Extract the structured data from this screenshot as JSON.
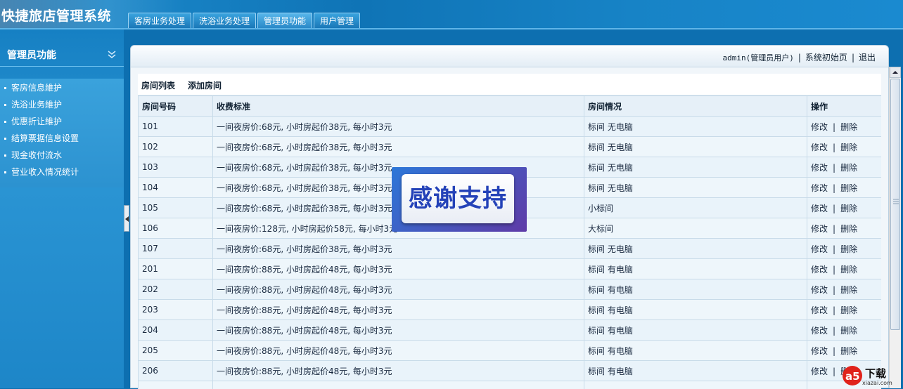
{
  "app": {
    "title": "快捷旅店管理系统"
  },
  "topnav": {
    "tabs": [
      {
        "label": "客房业务处理"
      },
      {
        "label": "洗浴业务处理"
      },
      {
        "label": "管理员功能"
      },
      {
        "label": "用户管理"
      }
    ],
    "active_index": 2
  },
  "sidebar": {
    "title": "管理员功能",
    "items": [
      {
        "label": "客房信息維护"
      },
      {
        "label": "洗浴业务維护"
      },
      {
        "label": "优惠折让維护"
      },
      {
        "label": "结算票据信息设置"
      },
      {
        "label": "现金收付流水"
      },
      {
        "label": "营业收入情况统计"
      }
    ]
  },
  "userbar": {
    "user": "admin(管理员用户)",
    "sep": "|",
    "home": "系统初始页",
    "logout": "退出"
  },
  "listbar": {
    "list_label": "房间列表",
    "add_label": "添加房间"
  },
  "table": {
    "headers": [
      "房间号码",
      "收费标准",
      "房间情况",
      "操作"
    ],
    "edit_label": "修改",
    "delete_label": "删除",
    "action_sep": "|",
    "rows": [
      {
        "no": "101",
        "fee": "一间夜房价:68元, 小时房起价38元, 每小时3元",
        "status": "标间 无电脑"
      },
      {
        "no": "102",
        "fee": "一间夜房价:68元, 小时房起价38元, 每小时3元",
        "status": "标间 无电脑"
      },
      {
        "no": "103",
        "fee": "一间夜房价:68元, 小时房起价38元, 每小时3元",
        "status": "标间 无电脑"
      },
      {
        "no": "104",
        "fee": "一间夜房价:68元, 小时房起价38元, 每小时3元",
        "status": "标间 无电脑"
      },
      {
        "no": "105",
        "fee": "一间夜房价:68元, 小时房起价38元, 每小时3元",
        "status": "小标间"
      },
      {
        "no": "106",
        "fee": "一间夜房价:128元, 小时房起价58元, 每小时3元",
        "status": "大标间"
      },
      {
        "no": "107",
        "fee": "一间夜房价:68元, 小时房起价38元, 每小时3元",
        "status": "标间 无电脑"
      },
      {
        "no": "201",
        "fee": "一间夜房价:88元, 小时房起价48元, 每小时3元",
        "status": "标间 有电脑"
      },
      {
        "no": "202",
        "fee": "一间夜房价:88元, 小时房起价48元, 每小时3元",
        "status": "标间 有电脑"
      },
      {
        "no": "203",
        "fee": "一间夜房价:88元, 小时房起价48元, 每小时3元",
        "status": "标间 有电脑"
      },
      {
        "no": "204",
        "fee": "一间夜房价:88元, 小时房起价48元, 每小时3元",
        "status": "标间 有电脑"
      },
      {
        "no": "205",
        "fee": "一间夜房价:88元, 小时房起价48元, 每小时3元",
        "status": "标间 有电脑"
      },
      {
        "no": "206",
        "fee": "一间夜房价:88元, 小时房起价48元, 每小时3元",
        "status": "标间 有电脑"
      },
      {
        "no": "",
        "fee": "",
        "status": ""
      }
    ]
  },
  "overlay": {
    "text": "感谢支持"
  },
  "watermark": {
    "brand": "下载",
    "url": "xiazai.com",
    "logo_colors": [
      "#e0231c",
      "#ffffff"
    ]
  },
  "colors": {
    "header": "#0f74b6",
    "sidebar": "#1d86c8",
    "accent": "#2442b8"
  }
}
